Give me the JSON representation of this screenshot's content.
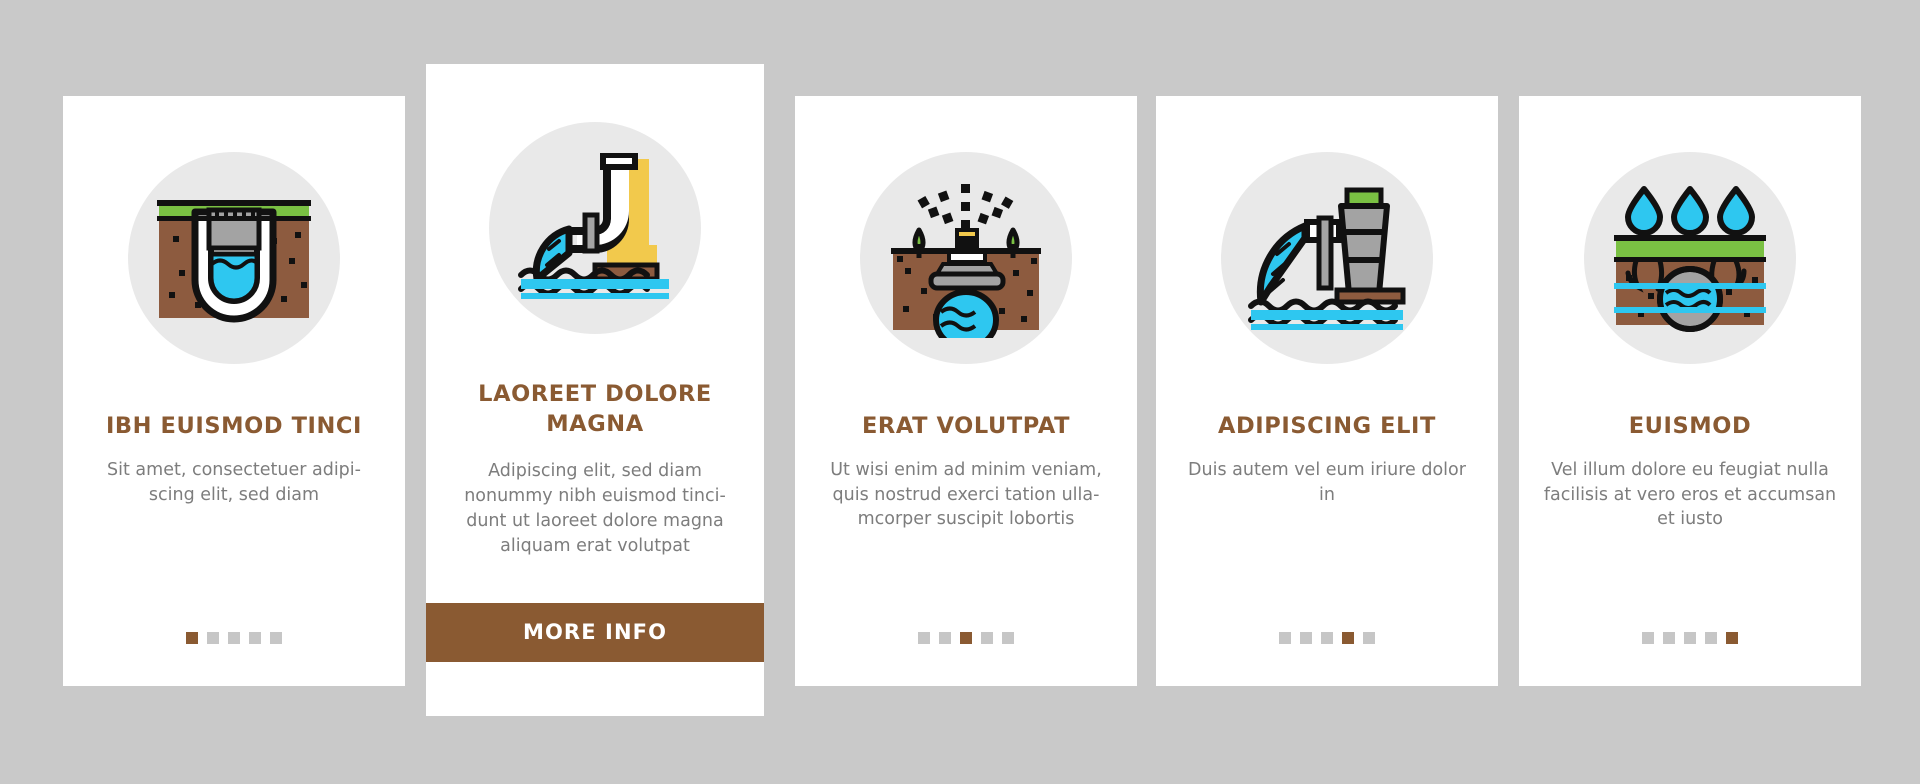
{
  "page": {
    "background_color": "#c9c9c9",
    "accent_color": "#8a5a32",
    "body_text_color": "#7d7d7d",
    "card_background": "#ffffff",
    "icon_circle_color": "#e9e9e9",
    "dot_inactive_color": "#c6c6c6"
  },
  "cards": [
    {
      "id": "card-1",
      "icon": "drainage-basin-icon",
      "title": "IBH EUISMOD TINCI",
      "description": "Sit amet, consectetuer adipi-scing elit, sed diam",
      "dots": {
        "count": 5,
        "active_index": 0
      },
      "featured": false
    },
    {
      "id": "card-2",
      "icon": "water-discharge-pipe-icon",
      "title": "LAOREET DOLORE MAGNA",
      "description": "Adipiscing elit, sed diam nonummy nibh euismod tinci-dunt ut laoreet dolore magna aliquam erat volutpat",
      "button_label": "MORE INFO",
      "featured": true
    },
    {
      "id": "card-3",
      "icon": "sprinkler-irrigation-icon",
      "title": "ERAT VOLUTPAT",
      "description": "Ut wisi enim ad minim veniam, quis nostrud exerci tation ulla-mcorper suscipit lobortis",
      "dots": {
        "count": 5,
        "active_index": 2
      },
      "featured": false
    },
    {
      "id": "card-4",
      "icon": "wastewater-outfall-icon",
      "title": "ADIPISCING ELIT",
      "description": "Duis autem vel eum iriure dolor in",
      "dots": {
        "count": 5,
        "active_index": 3
      },
      "featured": false
    },
    {
      "id": "card-5",
      "icon": "groundwater-infiltration-icon",
      "title": "EUISMOD",
      "description": "Vel illum dolore eu feugiat nulla facilisis at vero eros et accumsan et iusto",
      "dots": {
        "count": 5,
        "active_index": 4
      },
      "featured": false
    }
  ],
  "illustration_colors": {
    "grass_green": "#7ac143",
    "soil_brown": "#8d5b3f",
    "water_cyan": "#2ec7f0",
    "metal_gray": "#a3a3a3",
    "accent_yellow": "#f2c94c",
    "outline_black": "#111111",
    "white": "#ffffff"
  }
}
